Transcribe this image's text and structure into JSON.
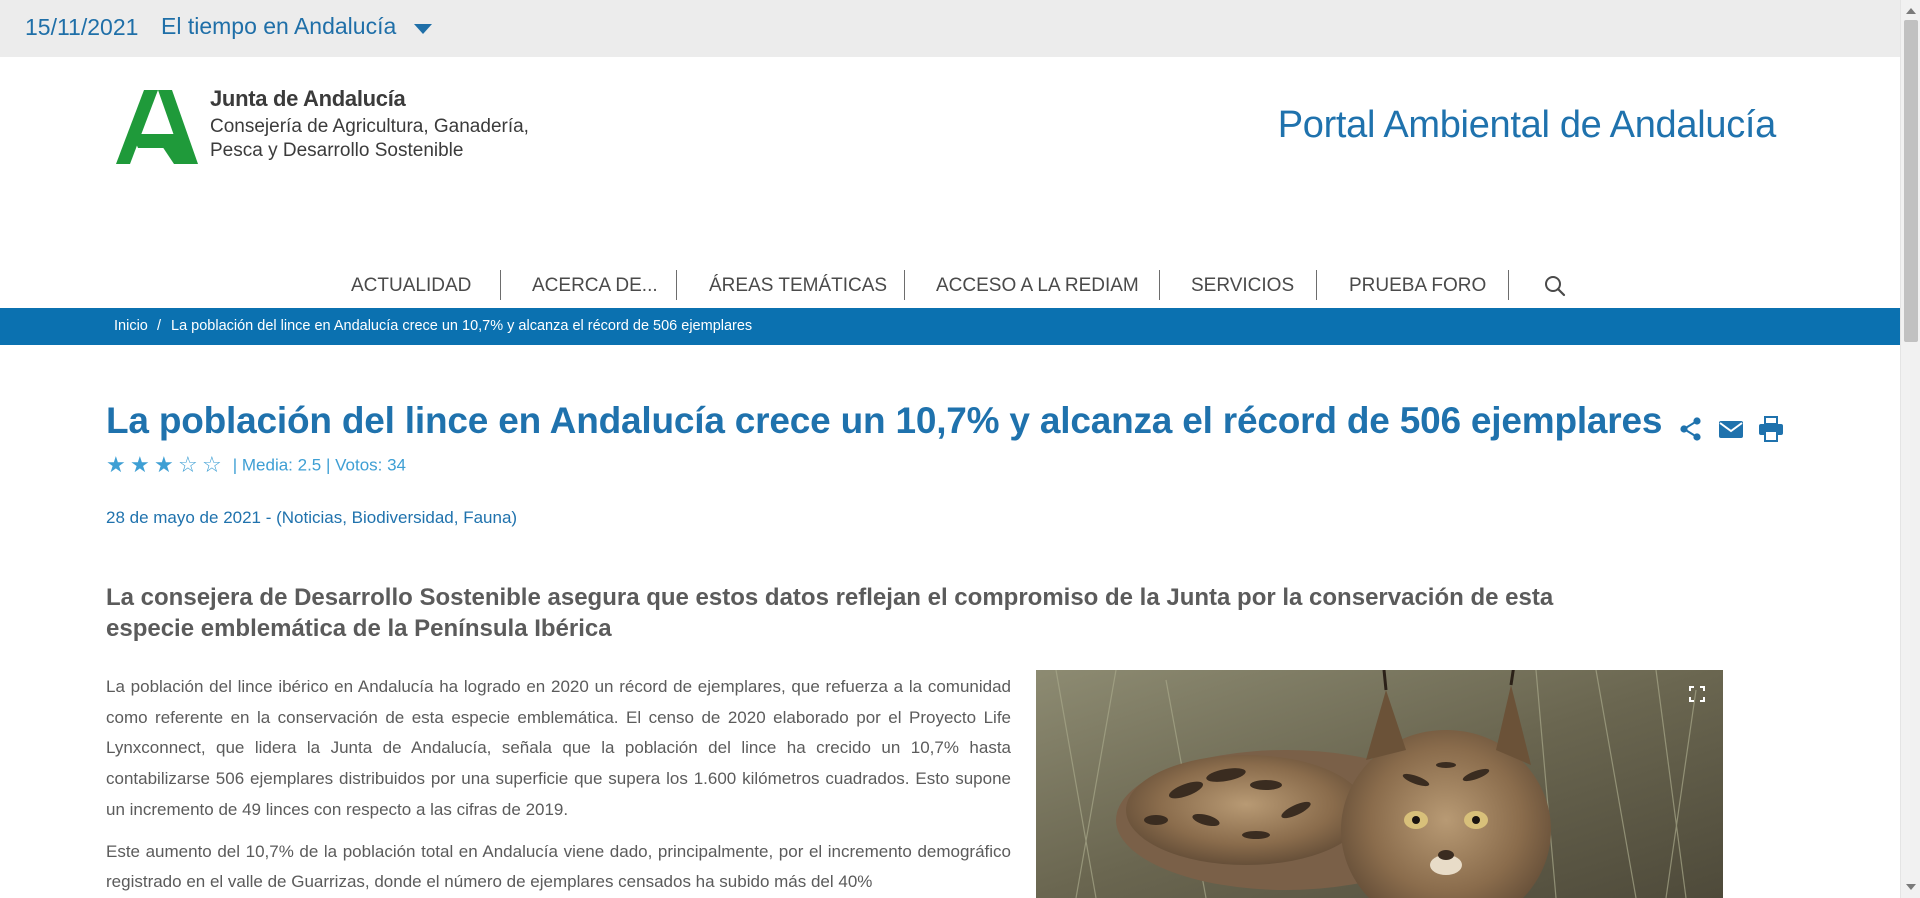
{
  "topbar": {
    "date": "15/11/2021",
    "weather_label": "El tiempo en Andalucía",
    "dropdown_icon": "caret-down-icon"
  },
  "logo": {
    "line1": "Junta de Andalucía",
    "line2": "Consejería de Agricultura, Ganadería,",
    "line3": "Pesca y Desarrollo Sostenible",
    "brand_color": "#1f9a3a"
  },
  "portal_title": "Portal Ambiental de Andalucía",
  "nav": {
    "items": [
      {
        "label": "ACTUALIDAD"
      },
      {
        "label": "ACERCA DE..."
      },
      {
        "label": "ÁREAS TEMÁTICAS"
      },
      {
        "label": "ACCESO A LA REDIAM"
      },
      {
        "label": "SERVICIOS"
      },
      {
        "label": "PRUEBA FORO"
      }
    ],
    "search_icon": "search-icon"
  },
  "breadcrumb": {
    "home": "Inicio",
    "separator": "/",
    "current": "La población del lince en Andalucía crece un 10,7% y alcanza el récord de 506 ejemplares",
    "background": "#0b71b0"
  },
  "article": {
    "title": "La población del lince en Andalucía crece un 10,7% y alcanza el récord de 506 ejemplares",
    "rating": {
      "stars_filled": 3,
      "stars_total": 5,
      "meta": "| Media: 2.5 | Votos: 34"
    },
    "dateline": "28 de mayo de 2021 - (Noticias, Biodiversidad, Fauna)",
    "lead": "La consejera de Desarrollo Sostenible asegura que estos datos reflejan el compromiso de la Junta por la conservación de esta especie emblemática de la Península Ibérica",
    "paragraphs": [
      "La población del lince ibérico en Andalucía ha logrado en 2020 un récord de ejemplares, que refuerza a la comunidad como referente en la conservación de esta especie emblemática. El censo de 2020 elaborado por el Proyecto Life Lynxconnect, que lidera la Junta de Andalucía, señala que la población del lince ha crecido un 10,7% hasta contabilizarse 506 ejemplares distribuidos por una superficie que supera los 1.600 kilómetros cuadrados. Esto supone un incremento de 49 linces con respecto a las cifras de 2019.",
      "Este aumento del 10,7% de la población total en Andalucía viene dado, principalmente, por el incremento demográfico registrado en el valle de Guarrizas, donde el número de ejemplares censados ha subido más del 40%"
    ],
    "actions": [
      "share-icon",
      "email-icon",
      "print-icon"
    ],
    "photo_expand_icon": "expand-icon"
  },
  "colors": {
    "accent": "#1f72ad",
    "star": "#3e9fd4",
    "text": "#5b5b5b"
  }
}
